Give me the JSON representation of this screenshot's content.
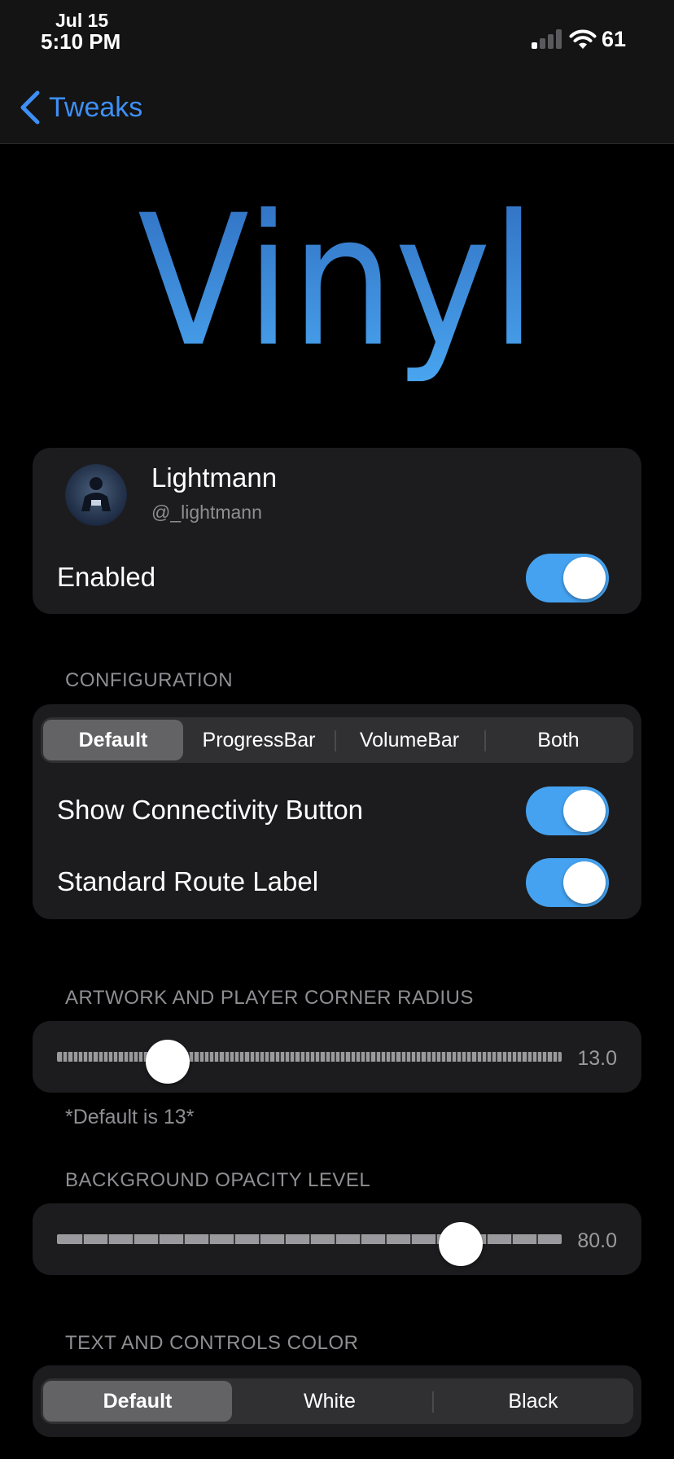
{
  "status_bar": {
    "date": "Jul 15",
    "time": "5:10 PM",
    "battery_percent": "61",
    "signal_bars_active": 1,
    "signal_bars_total": 4
  },
  "nav": {
    "back_label": "Tweaks"
  },
  "hero": {
    "title": "Vinyl",
    "gradient": [
      "#2f6dc0",
      "#4aa6f0"
    ]
  },
  "author": {
    "name": "Lightmann",
    "handle": "@_lightmann",
    "enabled_label": "Enabled",
    "enabled": true
  },
  "configuration": {
    "header": "CONFIGURATION",
    "segments": [
      "Default",
      "ProgressBar",
      "VolumeBar",
      "Both"
    ],
    "selected": "Default",
    "show_connectivity_label": "Show Connectivity Button",
    "show_connectivity": true,
    "standard_route_label": "Standard Route Label",
    "standard_route": true
  },
  "corner_radius": {
    "header": "ARTWORK AND PLAYER CORNER RADIUS",
    "value_text": "13.0",
    "fraction": 0.22,
    "footnote": "*Default is 13*"
  },
  "opacity": {
    "header": "BACKGROUND OPACITY LEVEL",
    "value_text": "80.0",
    "fraction": 0.8
  },
  "text_color": {
    "header": "TEXT AND CONTROLS COLOR",
    "segments": [
      "Default",
      "White",
      "Black"
    ],
    "selected": "Default"
  },
  "colors": {
    "accent": "#3e8ff5",
    "toggle_on": "#45a2f0",
    "card": "#1c1c1e",
    "secondary_text": "#8e8e93"
  }
}
